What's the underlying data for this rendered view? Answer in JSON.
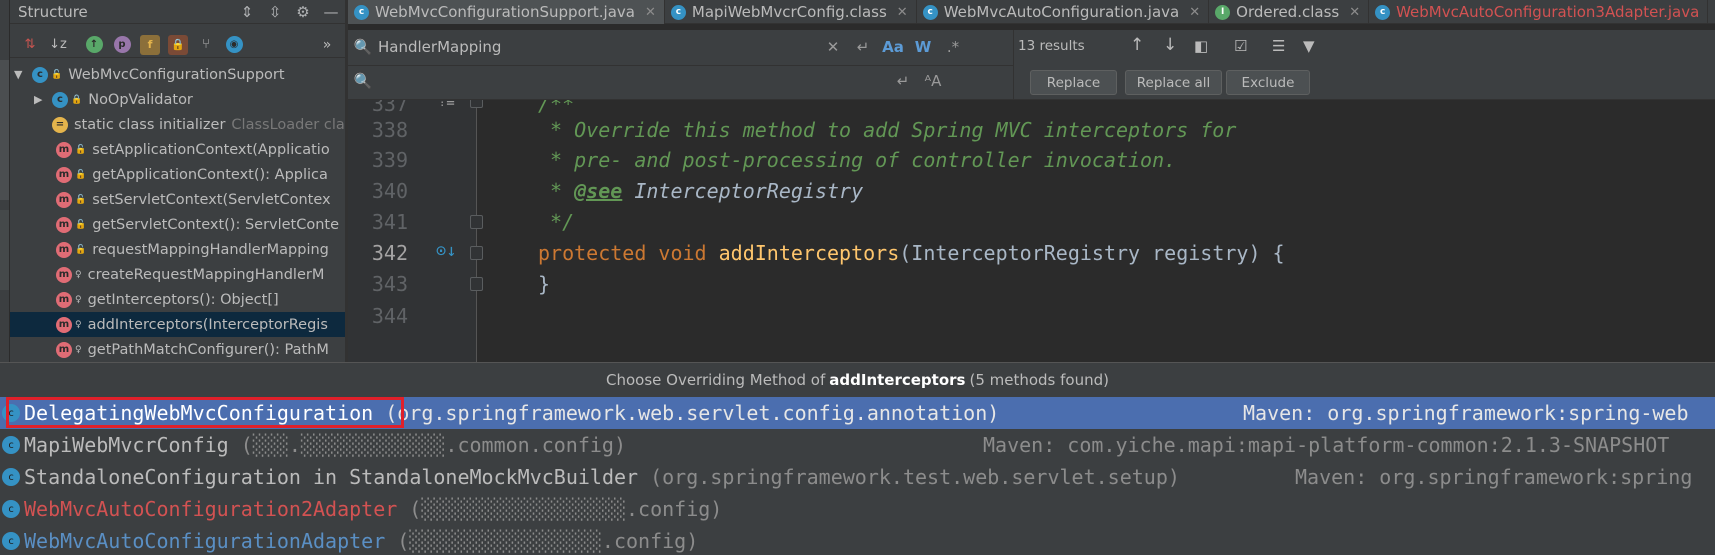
{
  "structure": {
    "title": "Structure",
    "root": "WebMvcConfigurationSupport",
    "items": [
      {
        "label": "NoOpValidator",
        "suffix": ""
      },
      {
        "label": "static class initializer",
        "suffix": "ClassLoader cla"
      },
      {
        "label": "setApplicationContext(Applicatio",
        "suffix": ""
      },
      {
        "label": "getApplicationContext(): Applica",
        "suffix": ""
      },
      {
        "label": "setServletContext(ServletContex",
        "suffix": ""
      },
      {
        "label": "getServletContext(): ServletConte",
        "suffix": ""
      },
      {
        "label": "requestMappingHandlerMapping",
        "suffix": ""
      },
      {
        "label": "createRequestMappingHandlerM",
        "suffix": ""
      },
      {
        "label": "getInterceptors(): Object[]",
        "suffix": ""
      },
      {
        "label": "addInterceptors(InterceptorRegis",
        "suffix": ""
      },
      {
        "label": "getPathMatchConfigurer(): PathM",
        "suffix": ""
      }
    ]
  },
  "tabs": [
    {
      "label": "WebMvcConfigurationSupport.java",
      "icon": "c"
    },
    {
      "label": "MapiWebMvcrConfig.class",
      "icon": "c"
    },
    {
      "label": "WebMvcAutoConfiguration.java",
      "icon": "c"
    },
    {
      "label": "Ordered.class",
      "icon": "i"
    },
    {
      "label": "WebMvcAutoConfiguration3Adapter.java",
      "icon": "c"
    }
  ],
  "search": {
    "find_value": "HandlerMapping",
    "replace_value": "",
    "results": "13 results",
    "match_case": "Aa",
    "words": "W",
    "regex": ".*",
    "replace_label": "Replace",
    "replace_all_label": "Replace all",
    "exclude_label": "Exclude"
  },
  "editor": {
    "line_numbers": [
      "337",
      "338",
      "339",
      "340",
      "341",
      "342",
      "343",
      "344"
    ],
    "lines": {
      "l337": "/**",
      "l338": " * Override this method to add Spring MVC interceptors for",
      "l339": " * pre- and post-processing of controller invocation.",
      "l340_star": " * ",
      "l340_tag": "@see",
      "l340_ref": " InterceptorRegistry",
      "l341": " */",
      "l342_kw1": "protected",
      "l342_kw2": "void",
      "l342_fn": "addInterceptors",
      "l342_rest": "(InterceptorRegistry registry) {",
      "l343": "}"
    }
  },
  "popup": {
    "title_prefix": "Choose Overriding Method of",
    "method": "addInterceptors",
    "title_suffix": "(5 methods found)",
    "rows": [
      {
        "name": "DelegatingWebMvcConfiguration",
        "pkg": "(org.springframework.web.servlet.config.annotation)",
        "maven": "Maven: org.springframework:spring-web"
      },
      {
        "name": "MapiWebMvcrConfig",
        "pkg": "(░░░.░░░░░░░░░░░░.common.config)",
        "maven": "Maven: com.yiche.mapi:mapi-platform-common:2.1.3-SNAPSHOT"
      },
      {
        "name": "StandaloneConfiguration in StandaloneMockMvcBuilder",
        "pkg": "(org.springframework.test.web.servlet.setup)",
        "maven": "Maven: org.springframework:spring"
      },
      {
        "name": "WebMvcAutoConfiguration2Adapter",
        "pkg": "(░░░░░░░░░░░░░░░░░.config)",
        "maven": ""
      },
      {
        "name": "WebMvcAutoConfigurationAdapter",
        "pkg": "(░░░░░░░░░░░░░░░░.config)",
        "maven": ""
      }
    ]
  }
}
